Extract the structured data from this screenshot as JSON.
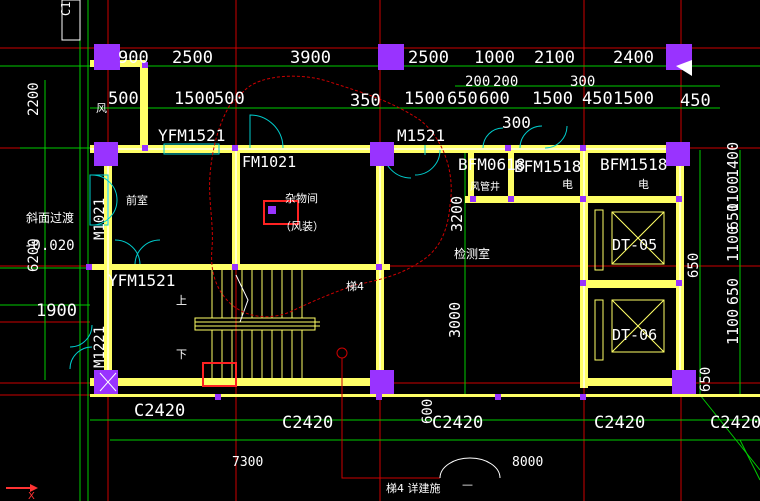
{
  "colors": {
    "background": "#000000",
    "wall": "#ffff66",
    "wall_core": "#ffffcc",
    "column": "#9933ff",
    "grid_line": "#cc0000",
    "dim_line": "#00cc00",
    "cloud": "#cc0000",
    "door": "#00cccc",
    "highlight": "#ff2222",
    "text": "#ffffff"
  },
  "top_edge_label": "C1",
  "dimensions": {
    "top_row1": [
      "900",
      "2500",
      "3900",
      "2500",
      "1000",
      "2100",
      "2400"
    ],
    "top_row2": [
      "500",
      "1500",
      "500",
      "350",
      "1500",
      "650",
      "600",
      "1500",
      "450",
      "1500",
      "450"
    ],
    "top_row2_small": [
      "200",
      "200",
      "300"
    ],
    "top_row3": [
      "300"
    ],
    "left": [
      "2200",
      "6200",
      "1900"
    ],
    "right": [
      "1400",
      "1100",
      "650",
      "1100",
      "650",
      "1100",
      "650",
      "650"
    ],
    "inner_vertical": [
      "3200",
      "3000",
      "600"
    ],
    "bottom": [
      "7300",
      "8000"
    ],
    "level": "-0.020"
  },
  "doors_windows": {
    "yfm1521_top": "YFM1521",
    "fm1021": "FM1021",
    "m1521": "M1521",
    "bm0618": "BFM0618",
    "bfm1518_a": "BFM1518",
    "bfm1518_b": "BFM1518",
    "m1021_v": "M1021",
    "yfm1521_mid": "YFM1521",
    "m1221_v": "M1221",
    "c2420_1": "C2420",
    "c2420_2": "C2420",
    "c2420_3": "C2420",
    "c2420_4": "C2420",
    "c2420_5": "C2420",
    "dt05": "DT-05",
    "dt06": "DT-06"
  },
  "rooms": {
    "feng": "风",
    "qianshi": "前室",
    "zawujian": "杂物间",
    "fengzhuang": "（风装）",
    "sloped_passage": "斜面过渡",
    "shang": "上",
    "xia": "下",
    "stair_label": "梯4",
    "jianceshi": "检测室",
    "kongguanjing": "风管井",
    "dian1": "电",
    "dian2": "电",
    "stair_detail": "梯4 详建施",
    "stair_detail_sub": "—"
  },
  "axis_marker": "X"
}
